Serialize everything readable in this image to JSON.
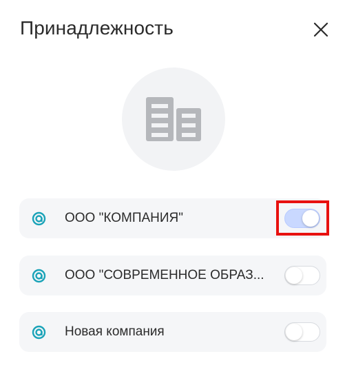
{
  "dialog": {
    "title": "Принадлежность",
    "close_icon": "close-icon",
    "avatar_icon": "building-icon"
  },
  "companies": [
    {
      "name": "ООО \"КОМПАНИЯ\"",
      "enabled": true,
      "logo_icon": "company-logo-icon"
    },
    {
      "name": "ООО \"СОВРЕМЕННОЕ ОБРАЗ...",
      "enabled": false,
      "logo_icon": "company-logo-icon"
    },
    {
      "name": "Новая компания",
      "enabled": false,
      "logo_icon": "company-logo-icon"
    }
  ],
  "colors": {
    "logo_accent": "#1aa3b8",
    "toggle_on": "#c9d8ff",
    "highlight": "#e8110f",
    "icon_gray": "#b5b7bb"
  }
}
